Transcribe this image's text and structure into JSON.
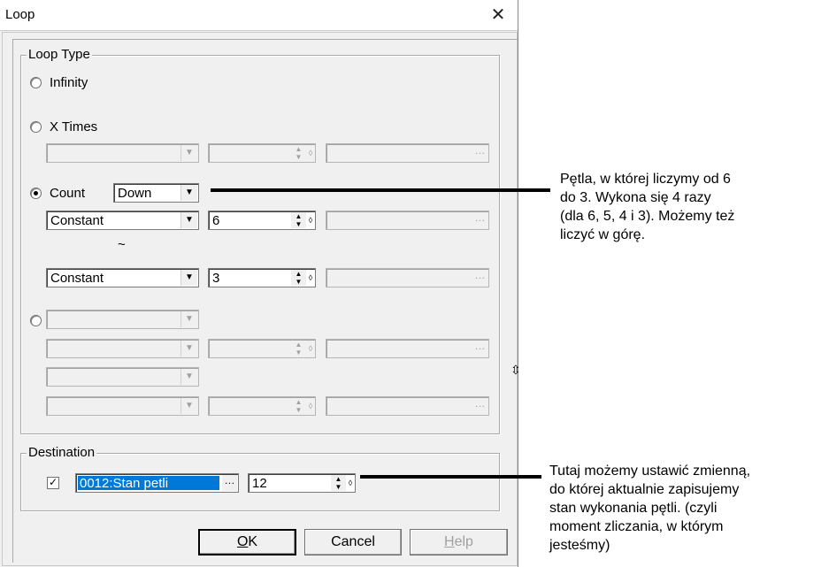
{
  "window": {
    "title": "Loop",
    "close_glyph": "✕"
  },
  "loop_type": {
    "label": "Loop Type",
    "infinity_label": "Infinity",
    "x_times_label": "X Times",
    "count_label": "Count",
    "count_direction": "Down",
    "start": {
      "type": "Constant",
      "value": "6"
    },
    "tilde": "~",
    "end": {
      "type": "Constant",
      "value": "3"
    }
  },
  "destination": {
    "label": "Destination",
    "checked": true,
    "variable": "0012:Stan petli",
    "value": "12"
  },
  "buttons": {
    "ok": "OK",
    "cancel": "Cancel",
    "help": "Help"
  },
  "annotations": {
    "count_note": [
      "Pętla, w której liczymy od 6",
      "do 3. Wykona się 4 razy",
      "(dla 6, 5, 4 i 3). Możemy też",
      "liczyć w górę."
    ],
    "destination_note": [
      "Tutaj możemy ustawić zmienną,",
      "do której aktualnie zapisujemy",
      "stan wykonania pętli. (czyli",
      "moment zliczania, w którym",
      "jesteśmy)"
    ]
  },
  "glyphs": {
    "dropdown": "▼",
    "up": "▲",
    "down": "▼",
    "diamond": "◊",
    "ellipsis": "…",
    "check": "✓"
  }
}
